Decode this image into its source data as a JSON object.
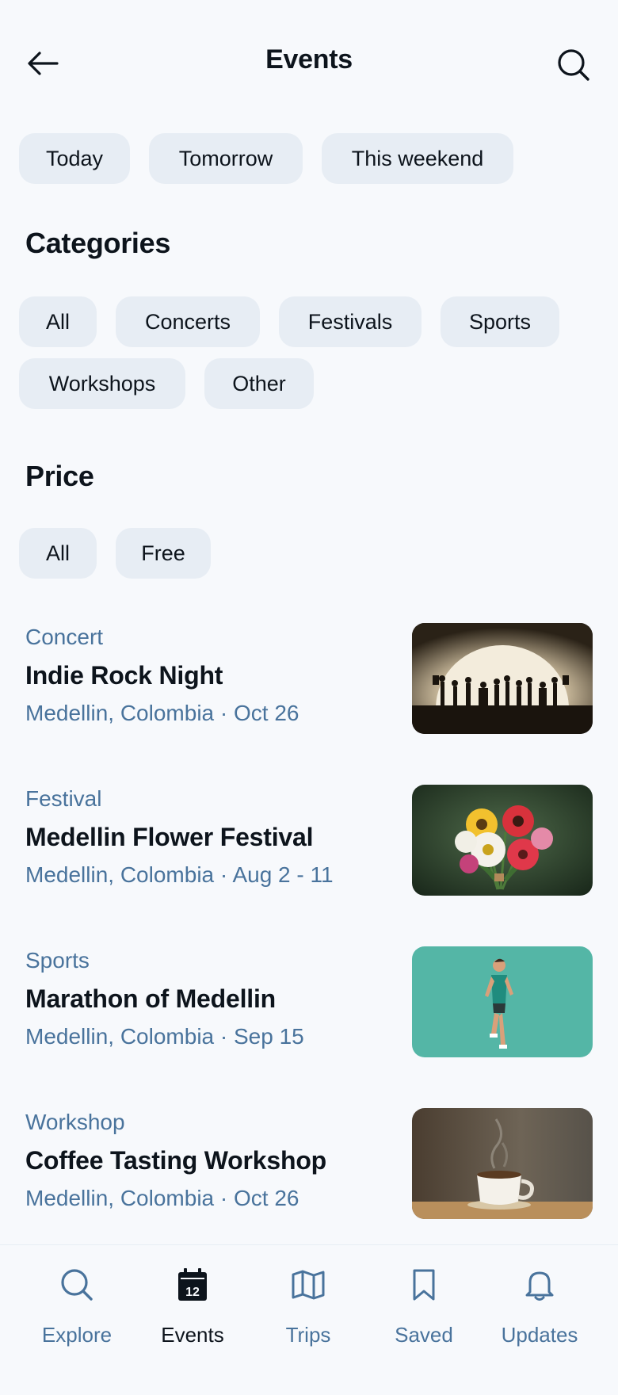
{
  "header": {
    "title": "Events"
  },
  "date_filters": [
    {
      "label": "Today"
    },
    {
      "label": "Tomorrow"
    },
    {
      "label": "This weekend"
    }
  ],
  "categories": {
    "title": "Categories",
    "items": [
      {
        "label": "All"
      },
      {
        "label": "Concerts"
      },
      {
        "label": "Festivals"
      },
      {
        "label": "Sports"
      },
      {
        "label": "Workshops"
      },
      {
        "label": "Other"
      }
    ]
  },
  "price": {
    "title": "Price",
    "items": [
      {
        "label": "All"
      },
      {
        "label": "Free"
      }
    ]
  },
  "events": [
    {
      "category": "Concert",
      "name": "Indie Rock Night",
      "location": "Medellin, Colombia",
      "date": "Oct 26",
      "image": "concert-stage-silhouette"
    },
    {
      "category": "Festival",
      "name": "Medellin Flower Festival",
      "location": "Medellin, Colombia",
      "date": "Aug 2 - 11",
      "image": "flower-bouquet"
    },
    {
      "category": "Sports",
      "name": "Marathon of Medellin",
      "location": "Medellin, Colombia",
      "date": "Sep 15",
      "image": "marathon-runner"
    },
    {
      "category": "Workshop",
      "name": "Coffee Tasting Workshop",
      "location": "Medellin, Colombia",
      "date": "Oct 26",
      "image": "coffee-cup"
    }
  ],
  "nav": [
    {
      "label": "Explore",
      "icon": "search-icon",
      "active": false
    },
    {
      "label": "Events",
      "icon": "calendar-icon",
      "active": true,
      "calendar_day": "12"
    },
    {
      "label": "Trips",
      "icon": "map-icon",
      "active": false
    },
    {
      "label": "Saved",
      "icon": "bookmark-icon",
      "active": false
    },
    {
      "label": "Updates",
      "icon": "bell-icon",
      "active": false
    }
  ],
  "colors": {
    "background": "#f7f9fc",
    "chip": "#e7edf4",
    "text": "#0d141c",
    "secondary": "#49739c"
  }
}
